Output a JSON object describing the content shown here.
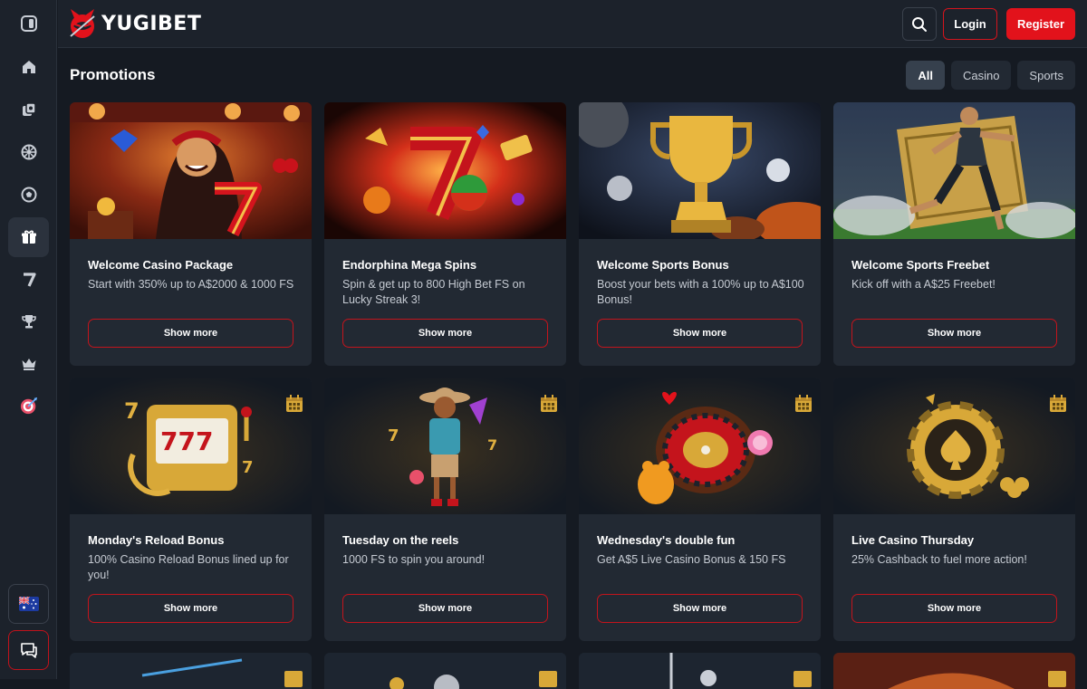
{
  "brand": {
    "name": "YUGIBET",
    "accent": "#e2121b"
  },
  "header": {
    "login_label": "Login",
    "register_label": "Register"
  },
  "sidebar": {
    "items": [
      "toggle-sidebar-icon",
      "home-icon",
      "casino-chips-icon",
      "roulette-icon",
      "sports-ball-icon",
      "gift-icon",
      "seven-icon",
      "trophy-icon",
      "crown-icon",
      "target-icon"
    ],
    "active": "gift-icon",
    "bottom": [
      "australia-flag-icon",
      "chat-icon"
    ]
  },
  "main": {
    "title": "Promotions",
    "filters": [
      {
        "label": "All",
        "active": true
      },
      {
        "label": "Casino",
        "active": false
      },
      {
        "label": "Sports",
        "active": false
      }
    ],
    "promos": [
      {
        "title": "Welcome Casino Package",
        "desc": "Start with 350% up to A$2000 & 1000 FS",
        "button": "Show more"
      },
      {
        "title": "Endorphina Mega Spins",
        "desc": "Spin & get up to 800 High Bet FS on Lucky Streak 3!",
        "button": "Show more"
      },
      {
        "title": "Welcome Sports Bonus",
        "desc": "Boost your bets with a 100% up to A$100 Bonus!",
        "button": "Show more"
      },
      {
        "title": "Welcome Sports Freebet",
        "desc": "Kick off with a A$25 Freebet!",
        "button": "Show more"
      },
      {
        "title": "Monday's Reload Bonus",
        "desc": "100% Casino Reload Bonus lined up for you!",
        "button": "Show more"
      },
      {
        "title": "Tuesday on the reels",
        "desc": "1000 FS to spin you around!",
        "button": "Show more"
      },
      {
        "title": "Wednesday's double fun",
        "desc": "Get A$5 Live Casino Bonus & 150 FS",
        "button": "Show more"
      },
      {
        "title": "Live Casino Thursday",
        "desc": "25% Cashback to fuel more action!",
        "button": "Show more"
      }
    ]
  }
}
